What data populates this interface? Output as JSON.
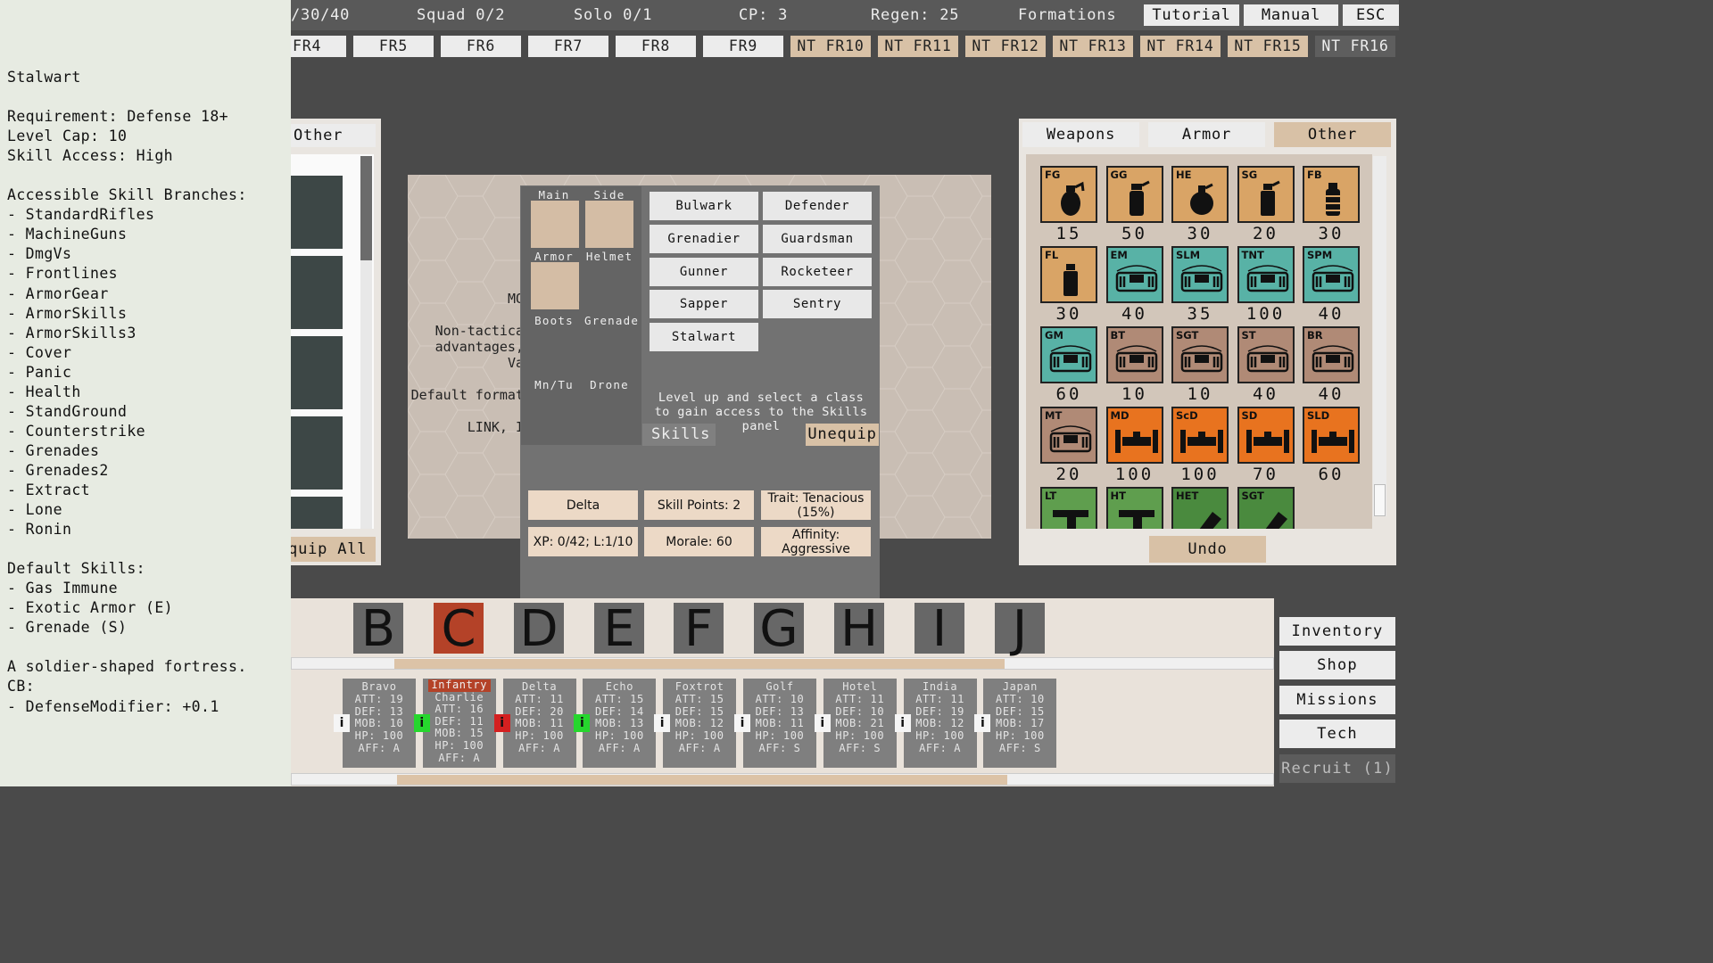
{
  "info_panel": {
    "text": "Stalwart\n\nRequirement: Defense 18+\nLevel Cap: 10\nSkill Access: High\n\nAccessible Skill Branches:\n- StandardRifles\n- MachineGuns\n- DmgVs\n- Frontlines\n- ArmorGear\n- ArmorSkills\n- ArmorSkills3\n- Cover\n- Panic\n- Health\n- StandGround\n- Counterstrike\n- Grenades\n- Grenades2\n- Extract\n- Lone\n- Ronin\n\nDefault Skills:\n- Gas Immune\n- Exotic Armor (E)\n- Grenade (S)\n\nA soldier-shaped fortress.\nCB:\n- DefenseModifier: +0.1"
  },
  "topbar": {
    "count": "/30/40",
    "squad": "Squad 0/2",
    "solo": "Solo 0/1",
    "cp": "CP: 3",
    "regen": "Regen: 25",
    "formations": "Formations",
    "tutorial": "Tutorial",
    "manual": "Manual",
    "esc": "ESC"
  },
  "formation_tabs": [
    "FR4",
    "FR5",
    "FR6",
    "FR7",
    "FR8",
    "FR9",
    "NT FR10",
    "NT FR11",
    "NT FR12",
    "NT FR13",
    "NT FR14",
    "NT FR15",
    "NT FR16"
  ],
  "board": {
    "text": "MO\n\nNon-tactica\nadvantages,\nVa\n\nDefault format\n\nLINK, I"
  },
  "left_inventory": {
    "tab": "Other",
    "equip_all": "Equip All"
  },
  "popup": {
    "slot_labels": {
      "main": "Main",
      "side": "Side",
      "armor": "Armor",
      "helmet": "Helmet",
      "boots": "Boots",
      "grenade": "Grenade",
      "mntu": "Mn/Tu",
      "drone": "Drone"
    },
    "classes": [
      "Bulwark",
      "Defender",
      "Grenadier",
      "Guardsman",
      "Gunner",
      "Rocketeer",
      "Sapper",
      "Sentry",
      "Stalwart"
    ],
    "level_text": "Level up and select a class to gain access to the Skills panel",
    "skills": "Skills",
    "unequip": "Unequip",
    "name": "Delta",
    "skill_points": "Skill Points: 2",
    "trait": "Trait: Tenacious (15%)",
    "xp": "XP: 0/42; L:1/10",
    "morale": "Morale: 60",
    "affinity": "Affinity: Aggressive"
  },
  "right_inventory": {
    "tabs": [
      "Weapons",
      "Armor",
      "Other"
    ],
    "undo": "Undo",
    "items": [
      {
        "code": "FG",
        "count": "15",
        "color": "#d9a466",
        "icon": "grenade-icon"
      },
      {
        "code": "GG",
        "count": "50",
        "color": "#d9a466",
        "icon": "gas-grenade-icon"
      },
      {
        "code": "HE",
        "count": "30",
        "color": "#d9a466",
        "icon": "bomb-icon"
      },
      {
        "code": "SG",
        "count": "20",
        "color": "#d9a466",
        "icon": "smoke-grenade-icon"
      },
      {
        "code": "FB",
        "count": "30",
        "color": "#d9a466",
        "icon": "flashbang-icon"
      },
      {
        "code": "FL",
        "count": "30",
        "color": "#d9a466",
        "icon": "flare-icon"
      },
      {
        "code": "EM",
        "count": "40",
        "color": "#58b2a6",
        "icon": "explosive-charge-icon"
      },
      {
        "code": "SLM",
        "count": "35",
        "color": "#58b2a6",
        "icon": "explosive-charge-icon"
      },
      {
        "code": "TNT",
        "count": "100",
        "color": "#58b2a6",
        "icon": "explosive-charge-icon"
      },
      {
        "code": "SPM",
        "count": "40",
        "color": "#58b2a6",
        "icon": "explosive-charge-icon"
      },
      {
        "code": "GM",
        "count": "60",
        "color": "#58b2a6",
        "icon": "explosive-charge-icon"
      },
      {
        "code": "BT",
        "count": "10",
        "color": "#b08a76",
        "icon": "explosive-charge-icon"
      },
      {
        "code": "SGT",
        "count": "10",
        "color": "#b08a76",
        "icon": "explosive-charge-icon"
      },
      {
        "code": "ST",
        "count": "40",
        "color": "#b08a76",
        "icon": "explosive-charge-icon"
      },
      {
        "code": "BR",
        "count": "40",
        "color": "#b08a76",
        "icon": "explosive-charge-icon"
      },
      {
        "code": "MT",
        "count": "20",
        "color": "#b08a76",
        "icon": "explosive-charge-icon"
      },
      {
        "code": "MD",
        "count": "100",
        "color": "#e8731f",
        "icon": "mine-icon"
      },
      {
        "code": "ScD",
        "count": "100",
        "color": "#e8731f",
        "icon": "mine-icon"
      },
      {
        "code": "SD",
        "count": "70",
        "color": "#e8731f",
        "icon": "mine-icon"
      },
      {
        "code": "SLD",
        "count": "60",
        "color": "#e8731f",
        "icon": "mine-icon"
      },
      {
        "code": "LT",
        "count": "",
        "color": "#5f9e4e",
        "icon": "turret-icon"
      },
      {
        "code": "HT",
        "count": "",
        "color": "#5f9e4e",
        "icon": "turret-icon"
      },
      {
        "code": "HET",
        "count": "",
        "color": "#4a8a3e",
        "icon": "launcher-turret-icon"
      },
      {
        "code": "SGT",
        "count": "",
        "color": "#4a8a3e",
        "icon": "launcher-turret-icon"
      }
    ]
  },
  "squad_letters": [
    "B",
    "C",
    "D",
    "E",
    "F",
    "G",
    "H",
    "I",
    "J"
  ],
  "soldiers": [
    {
      "name": "Bravo",
      "role": "",
      "att": "ATT: 19",
      "def": "DEF: 13",
      "mob": "MOB: 10",
      "hp": "HP: 100",
      "aff": "AFF: A",
      "info": "i",
      "info_state": "white"
    },
    {
      "name": "Charlie",
      "role": "Infantry",
      "att": "ATT: 16",
      "def": "DEF: 11",
      "mob": "MOB: 15",
      "hp": "HP: 100",
      "aff": "AFF: A",
      "info": "i",
      "info_state": "green"
    },
    {
      "name": "Delta",
      "role": "",
      "att": "ATT: 11",
      "def": "DEF: 20",
      "mob": "MOB: 11",
      "hp": "HP: 100",
      "aff": "AFF: A",
      "info": "i",
      "info_state": "red"
    },
    {
      "name": "Echo",
      "role": "",
      "att": "ATT: 15",
      "def": "DEF: 14",
      "mob": "MOB: 13",
      "hp": "HP: 100",
      "aff": "AFF: A",
      "info": "i",
      "info_state": "green"
    },
    {
      "name": "Foxtrot",
      "role": "",
      "att": "ATT: 15",
      "def": "DEF: 15",
      "mob": "MOB: 12",
      "hp": "HP: 100",
      "aff": "AFF: A",
      "info": "i",
      "info_state": "white"
    },
    {
      "name": "Golf",
      "role": "",
      "att": "ATT: 10",
      "def": "DEF: 13",
      "mob": "MOB: 11",
      "hp": "HP: 100",
      "aff": "AFF: S",
      "info": "i",
      "info_state": "white"
    },
    {
      "name": "Hotel",
      "role": "",
      "att": "ATT: 11",
      "def": "DEF: 10",
      "mob": "MOB: 21",
      "hp": "HP: 100",
      "aff": "AFF: S",
      "info": "i",
      "info_state": "white"
    },
    {
      "name": "India",
      "role": "",
      "att": "ATT: 11",
      "def": "DEF: 19",
      "mob": "MOB: 12",
      "hp": "HP: 100",
      "aff": "AFF: A",
      "info": "i",
      "info_state": "white"
    },
    {
      "name": "Japan",
      "role": "",
      "att": "ATT: 10",
      "def": "DEF: 15",
      "mob": "MOB: 17",
      "hp": "HP: 100",
      "aff": "AFF: S",
      "info": "i",
      "info_state": "white"
    }
  ],
  "side_menu": {
    "inventory": "Inventory",
    "shop": "Shop",
    "missions": "Missions",
    "tech": "Tech",
    "recruit": "Recruit (1)"
  },
  "colors": {
    "accent_tan": "#d8c1a6",
    "selected_red": "#b44228",
    "info_green": "#26d62d",
    "info_red": "#d42020"
  }
}
